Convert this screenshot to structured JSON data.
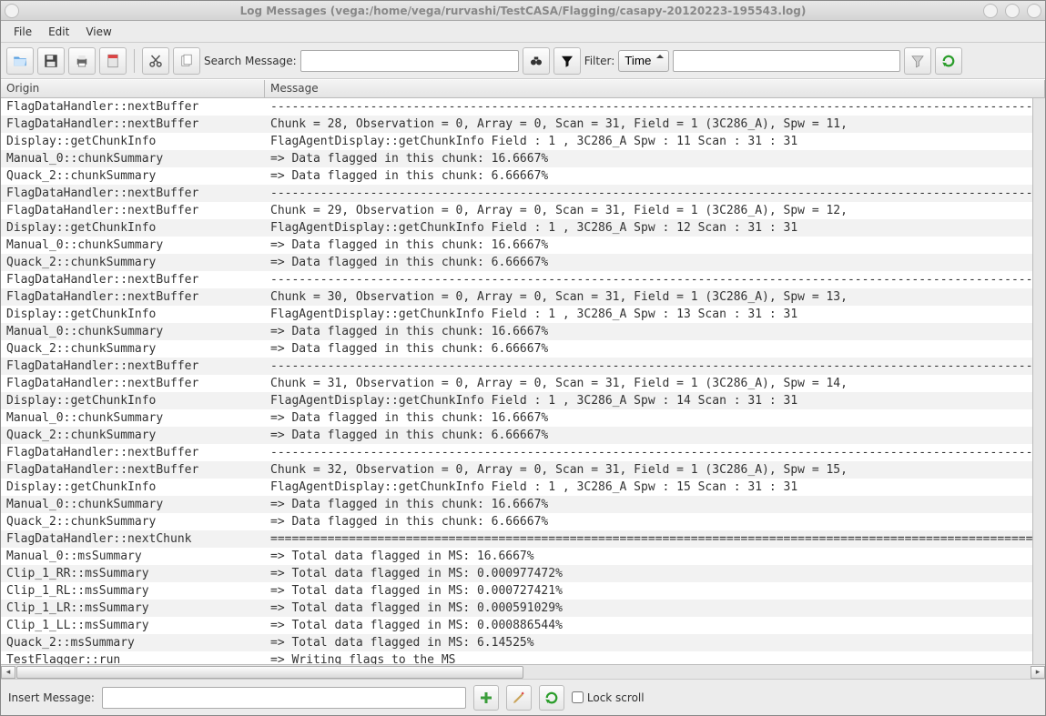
{
  "window": {
    "title": "Log Messages (vega:/home/vega/rurvashi/TestCASA/Flagging/casapy-20120223-195543.log)"
  },
  "menu": {
    "file": "File",
    "edit": "Edit",
    "view": "View"
  },
  "toolbar": {
    "search_label": "Search Message:",
    "search_value": "",
    "filter_label": "Filter:",
    "filter_selected": "Time",
    "filter_value": ""
  },
  "columns": {
    "origin": "Origin",
    "message": "Message"
  },
  "rows": [
    {
      "origin": "FlagDataHandler::nextBuffer",
      "message": "------------------------------------------------------------------------------------------------------------------------"
    },
    {
      "origin": "FlagDataHandler::nextBuffer",
      "message": "Chunk = 28, Observation = 0, Array = 0, Scan = 31, Field = 1 (3C286_A), Spw = 11,"
    },
    {
      "origin": "Display::getChunkInfo",
      "message": "FlagAgentDisplay::getChunkInfo Field : 1 , 3C286_A Spw : 11 Scan : 31 : 31"
    },
    {
      "origin": "Manual_0::chunkSummary",
      "message": "=> Data flagged in this chunk: 16.6667%"
    },
    {
      "origin": "Quack_2::chunkSummary",
      "message": "=> Data flagged in this chunk: 6.66667%"
    },
    {
      "origin": "FlagDataHandler::nextBuffer",
      "message": "------------------------------------------------------------------------------------------------------------------------"
    },
    {
      "origin": "FlagDataHandler::nextBuffer",
      "message": "Chunk = 29, Observation = 0, Array = 0, Scan = 31, Field = 1 (3C286_A), Spw = 12,"
    },
    {
      "origin": "Display::getChunkInfo",
      "message": "FlagAgentDisplay::getChunkInfo Field : 1 , 3C286_A Spw : 12 Scan : 31 : 31"
    },
    {
      "origin": "Manual_0::chunkSummary",
      "message": "=> Data flagged in this chunk: 16.6667%"
    },
    {
      "origin": "Quack_2::chunkSummary",
      "message": "=> Data flagged in this chunk: 6.66667%"
    },
    {
      "origin": "FlagDataHandler::nextBuffer",
      "message": "------------------------------------------------------------------------------------------------------------------------"
    },
    {
      "origin": "FlagDataHandler::nextBuffer",
      "message": "Chunk = 30, Observation = 0, Array = 0, Scan = 31, Field = 1 (3C286_A), Spw = 13,"
    },
    {
      "origin": "Display::getChunkInfo",
      "message": "FlagAgentDisplay::getChunkInfo Field : 1 , 3C286_A Spw : 13 Scan : 31 : 31"
    },
    {
      "origin": "Manual_0::chunkSummary",
      "message": "=> Data flagged in this chunk: 16.6667%"
    },
    {
      "origin": "Quack_2::chunkSummary",
      "message": "=> Data flagged in this chunk: 6.66667%"
    },
    {
      "origin": "FlagDataHandler::nextBuffer",
      "message": "------------------------------------------------------------------------------------------------------------------------"
    },
    {
      "origin": "FlagDataHandler::nextBuffer",
      "message": "Chunk = 31, Observation = 0, Array = 0, Scan = 31, Field = 1 (3C286_A), Spw = 14,"
    },
    {
      "origin": "Display::getChunkInfo",
      "message": "FlagAgentDisplay::getChunkInfo Field : 1 , 3C286_A Spw : 14 Scan : 31 : 31"
    },
    {
      "origin": "Manual_0::chunkSummary",
      "message": "=> Data flagged in this chunk: 16.6667%"
    },
    {
      "origin": "Quack_2::chunkSummary",
      "message": "=> Data flagged in this chunk: 6.66667%"
    },
    {
      "origin": "FlagDataHandler::nextBuffer",
      "message": "------------------------------------------------------------------------------------------------------------------------"
    },
    {
      "origin": "FlagDataHandler::nextBuffer",
      "message": "Chunk = 32, Observation = 0, Array = 0, Scan = 31, Field = 1 (3C286_A), Spw = 15,"
    },
    {
      "origin": "Display::getChunkInfo",
      "message": "FlagAgentDisplay::getChunkInfo Field : 1 , 3C286_A Spw : 15 Scan : 31 : 31"
    },
    {
      "origin": "Manual_0::chunkSummary",
      "message": "=> Data flagged in this chunk: 16.6667%"
    },
    {
      "origin": "Quack_2::chunkSummary",
      "message": "=> Data flagged in this chunk: 6.66667%"
    },
    {
      "origin": "FlagDataHandler::nextChunk",
      "message": "========================================================================================================================"
    },
    {
      "origin": "Manual_0::msSummary",
      "message": "=> Total data flagged in MS: 16.6667%"
    },
    {
      "origin": "Clip_1_RR::msSummary",
      "message": "=> Total data flagged in MS: 0.000977472%"
    },
    {
      "origin": "Clip_1_RL::msSummary",
      "message": "=> Total data flagged in MS: 0.000727421%"
    },
    {
      "origin": "Clip_1_LR::msSummary",
      "message": "=> Total data flagged in MS: 0.000591029%"
    },
    {
      "origin": "Clip_1_LL::msSummary",
      "message": "=> Total data flagged in MS: 0.000886544%"
    },
    {
      "origin": "Quack_2::msSummary",
      "message": "=> Total data flagged in MS: 6.14525%"
    },
    {
      "origin": "TestFlagger::run",
      "message": "=> Writing flags to the MS"
    }
  ],
  "bottom": {
    "insert_label": "Insert Message:",
    "insert_value": "",
    "lock_label": "Lock scroll",
    "lock_checked": false
  }
}
